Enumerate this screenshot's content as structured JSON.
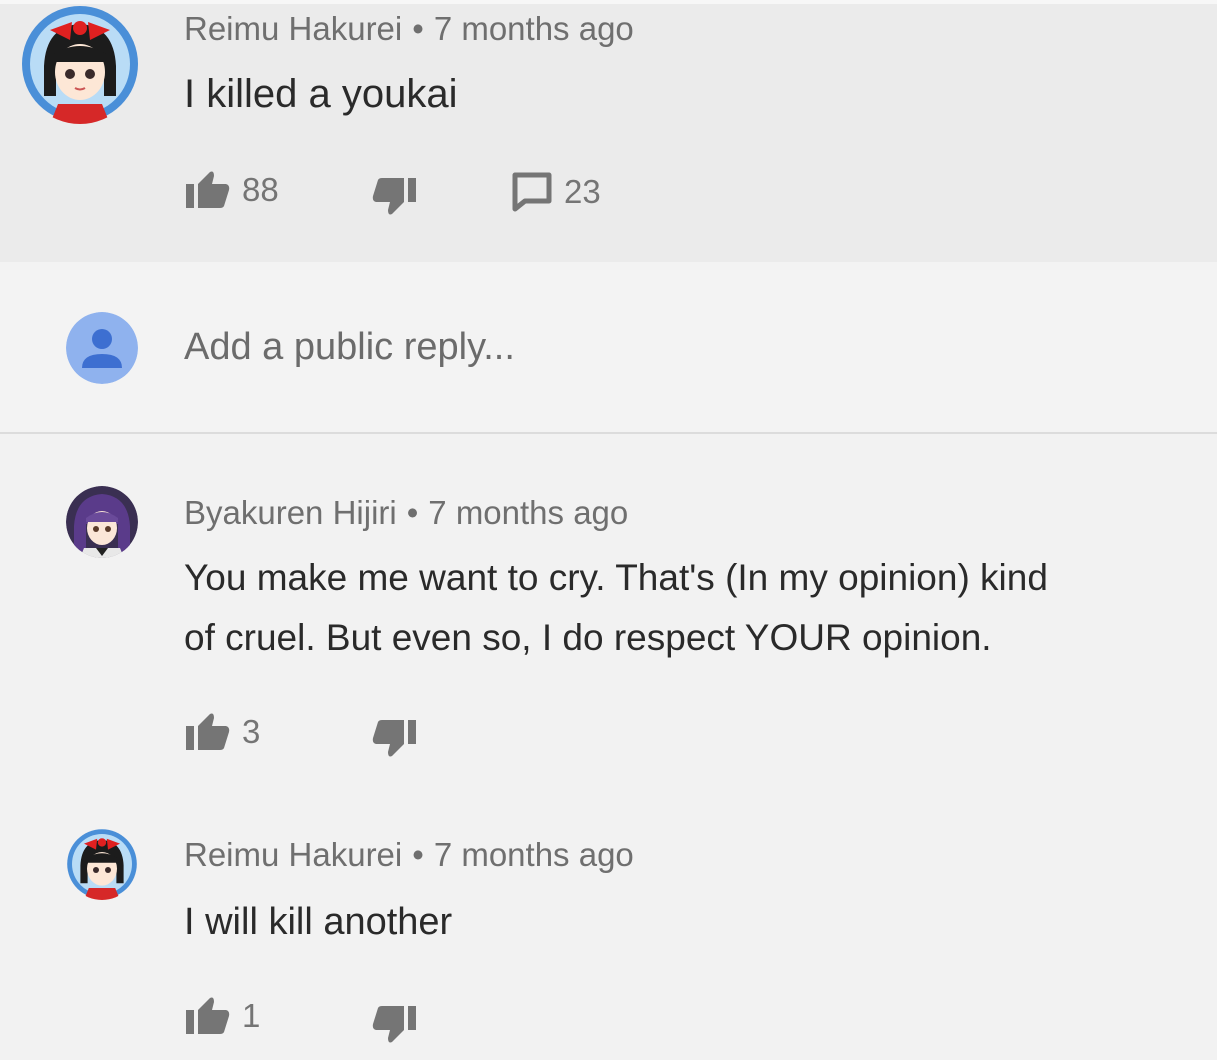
{
  "main_comment": {
    "author": "Reimu Hakurei",
    "separator": "•",
    "time": "7 months ago",
    "text": "I killed a youkai",
    "likes": "88",
    "replies": "23",
    "avatar_icon": "reimu-avatar"
  },
  "reply_box": {
    "placeholder": "Add a public reply...",
    "avatar_icon": "default-user-avatar"
  },
  "replies": [
    {
      "author": "Byakuren Hijiri",
      "separator": "•",
      "time": "7 months ago",
      "text_line1": "You make me want to cry. That's (In my opinion) kind",
      "text_line2": "of cruel. But even so, I do respect YOUR opinion.",
      "likes": "3",
      "avatar_icon": "byakuren-avatar"
    },
    {
      "author": "Reimu Hakurei",
      "separator": "•",
      "time": "7 months ago",
      "text": "I will kill another",
      "likes": "1",
      "avatar_icon": "reimu-avatar"
    }
  ],
  "colors": {
    "highlight_bg": "#ebebeb",
    "page_bg": "#f3f3f3",
    "icon_gray": "#757575",
    "default_avatar_blue": "#8fb2ee"
  }
}
